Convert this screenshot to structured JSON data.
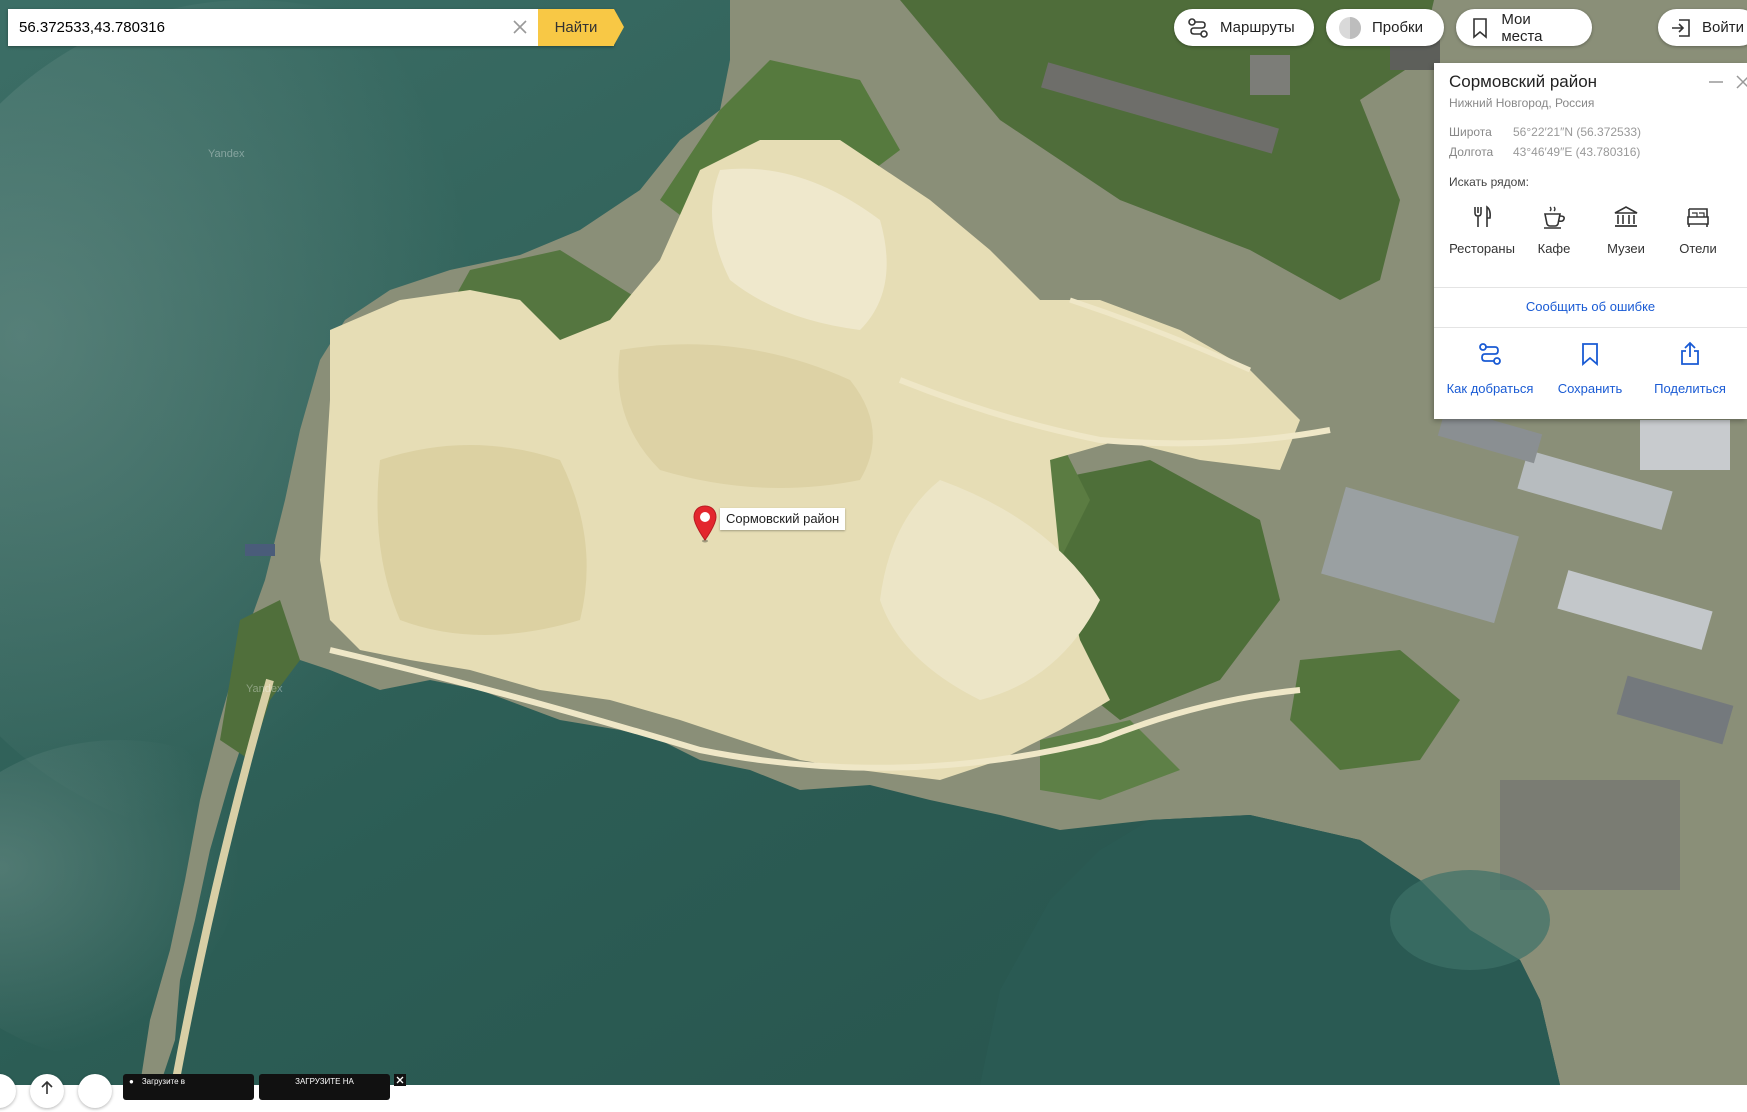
{
  "search": {
    "value": "56.372533,43.780316",
    "button_label": "Найти"
  },
  "top_buttons": {
    "routes": "Маршруты",
    "traffic": "Пробки",
    "my_places": "Мои места",
    "login": "Войти"
  },
  "card": {
    "title": "Сормовский район",
    "subtitle": "Нижний Новгород, Россия",
    "latitude_label": "Широта",
    "latitude_value": "56°22′21″N (56.372533)",
    "longitude_label": "Долгота",
    "longitude_value": "43°46′49″E (43.780316)",
    "nearby_label": "Искать рядом:",
    "nearby": [
      {
        "label": "Рестораны",
        "icon": "fork-knife-icon"
      },
      {
        "label": "Кафе",
        "icon": "coffee-cup-icon"
      },
      {
        "label": "Музеи",
        "icon": "museum-icon"
      },
      {
        "label": "Отели",
        "icon": "bed-icon"
      }
    ],
    "report_error": "Сообщить об ошибке",
    "actions": [
      {
        "label": "Как добраться",
        "icon": "route-icon"
      },
      {
        "label": "Сохранить",
        "icon": "bookmark-icon"
      },
      {
        "label": "Поделиться",
        "icon": "share-icon"
      }
    ]
  },
  "marker": {
    "label": "Сормовский район",
    "color": "#e3262d"
  },
  "watermarks": [
    "Yandex",
    "Yandex"
  ],
  "promo": {
    "apple_badge": "Загрузите в",
    "google_badge": "ЗАГРУЗИТЕ НА"
  },
  "colors": {
    "search_button": "#f8c845",
    "link": "#1a5bd4",
    "water": "#2e5f57",
    "sand": "#e8dfb8",
    "forest": "#4a6b36"
  }
}
